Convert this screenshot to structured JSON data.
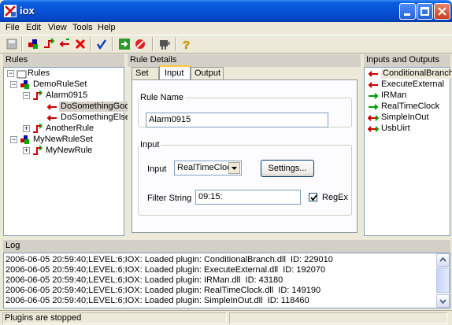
{
  "window": {
    "title": "iox"
  },
  "menu": [
    "File",
    "Edit",
    "View",
    "Tools",
    "Help"
  ],
  "toolbar": {
    "buttons": [
      "save-icon",
      "add-ruleset-icon",
      "add-rule-icon",
      "add-action-icon",
      "delete-icon",
      "check-icon",
      "run-icon",
      "stop-icon",
      "plugin-icon",
      "help-icon"
    ]
  },
  "rules": {
    "header": "Rules",
    "tree": {
      "root": "Rules",
      "demo_ruleset": "DemoRuleSet",
      "alarm": "Alarm0915",
      "do_good": "DoSomethingGood",
      "do_else": "DoSomethingElse",
      "another_rule": "AnotherRule",
      "my_ruleset": "MyNewRuleSet",
      "my_rule": "MyNewRule"
    }
  },
  "details": {
    "header": "Rule Details",
    "tabs": [
      "Set",
      "Input",
      "Output"
    ],
    "active_tab": "Input",
    "rule_name_label": "Rule Name",
    "rule_name_value": "Alarm0915",
    "input_group": "Input",
    "input_label": "Input",
    "input_select": "RealTimeClock",
    "settings_button": "Settings...",
    "filter_label": "Filter String",
    "filter_value": "09:15:",
    "regex_label": "RegEx",
    "regex_checked": true
  },
  "io": {
    "header": "Inputs and Outputs",
    "items": [
      {
        "label": "ConditionalBranch",
        "color": "#cc0000",
        "dir": "left"
      },
      {
        "label": "ExecuteExternal",
        "color": "#cc0000",
        "dir": "left"
      },
      {
        "label": "IRMan",
        "color": "#00a000",
        "dir": "right"
      },
      {
        "label": "RealTimeClock",
        "color": "#00a000",
        "dir": "right"
      },
      {
        "label": "SimpleInOut",
        "color": "#cc0000",
        "dir": "both"
      },
      {
        "label": "UsbUirt",
        "color": "#cc0000",
        "dir": "both"
      }
    ]
  },
  "log": {
    "header": "Log",
    "lines": [
      "2006-06-05 20:59:40;LEVEL:6;IOX: Loaded plugin: ConditionalBranch.dll  ID: 229010",
      "2006-06-05 20:59:40;LEVEL:6;IOX: Loaded plugin: ExecuteExternal.dll  ID: 192070",
      "2006-06-05 20:59:40;LEVEL:6;IOX: Loaded plugin: IRMan.dll  ID: 43180",
      "2006-06-05 20:59:40;LEVEL:6;IOX: Loaded plugin: RealTimeClock.dll  ID: 149190",
      "2006-06-05 20:59:40;LEVEL:6;IOX: Loaded plugin: SimpleInOut.dll  ID: 118460"
    ]
  },
  "status": {
    "text": "Plugins are stopped"
  }
}
